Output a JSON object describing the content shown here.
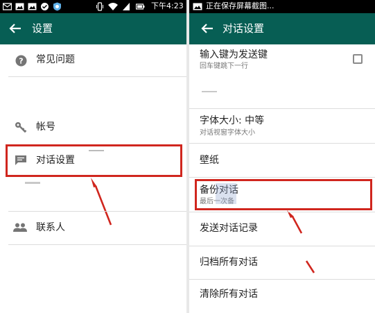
{
  "left": {
    "status": {
      "time": "下午4:23"
    },
    "toolbar": {
      "title": "设置"
    },
    "items": [
      {
        "label": "常见问题"
      },
      {
        "label": "帐号"
      },
      {
        "label": "对话设置"
      },
      {
        "label": "联系人"
      }
    ]
  },
  "right": {
    "status": {
      "notification": "正在保存屏幕截图..."
    },
    "toolbar": {
      "title": "对话设置"
    },
    "enter_send": {
      "label": "输入键为发送键",
      "sub": "回车键跳下一行",
      "checked": false
    },
    "font_size": {
      "label": "字体大小: 中等",
      "sub": "对话视窗字体大小"
    },
    "wallpaper": {
      "label": "壁纸"
    },
    "backup": {
      "label": "备份对话",
      "sub": "最后一次备"
    },
    "email_chat": {
      "label": "发送对话记录"
    },
    "archive_all": {
      "label": "归档所有对话"
    },
    "clear_all": {
      "label": "清除所有对话"
    }
  },
  "colors": {
    "toolbar": "#075e54",
    "highlight": "#d0261e",
    "statusbar": "#000000"
  }
}
